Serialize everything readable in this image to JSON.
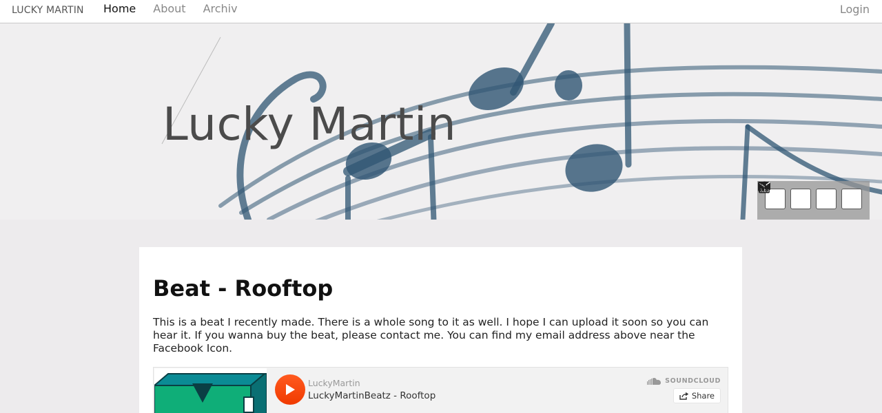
{
  "nav": {
    "brand": "LUCKY MARTIN",
    "links": [
      {
        "label": "Home",
        "active": true
      },
      {
        "label": "About",
        "active": false
      },
      {
        "label": "Archiv",
        "active": false
      }
    ],
    "login": "Login"
  },
  "header": {
    "title": "Lucky Martin",
    "social": [
      {
        "icon": "facebook-icon"
      },
      {
        "icon": "email-icon"
      },
      {
        "icon": "youtube-icon"
      },
      {
        "icon": "rss-icon"
      }
    ]
  },
  "post": {
    "title": "Beat - Rooftop",
    "body": "This is a beat I recently made. There is a whole song to it as well. I hope I can upload it soon so you can hear it. If you wanna buy the beat, please contact me. You can find my email address above near the Facebook Icon."
  },
  "player": {
    "user": "LuckyMartin",
    "track": "LuckyMartinBeatz - Rooftop",
    "brand": "SOUNDCLOUD",
    "share": "Share",
    "accent": "#ff4f0f"
  }
}
